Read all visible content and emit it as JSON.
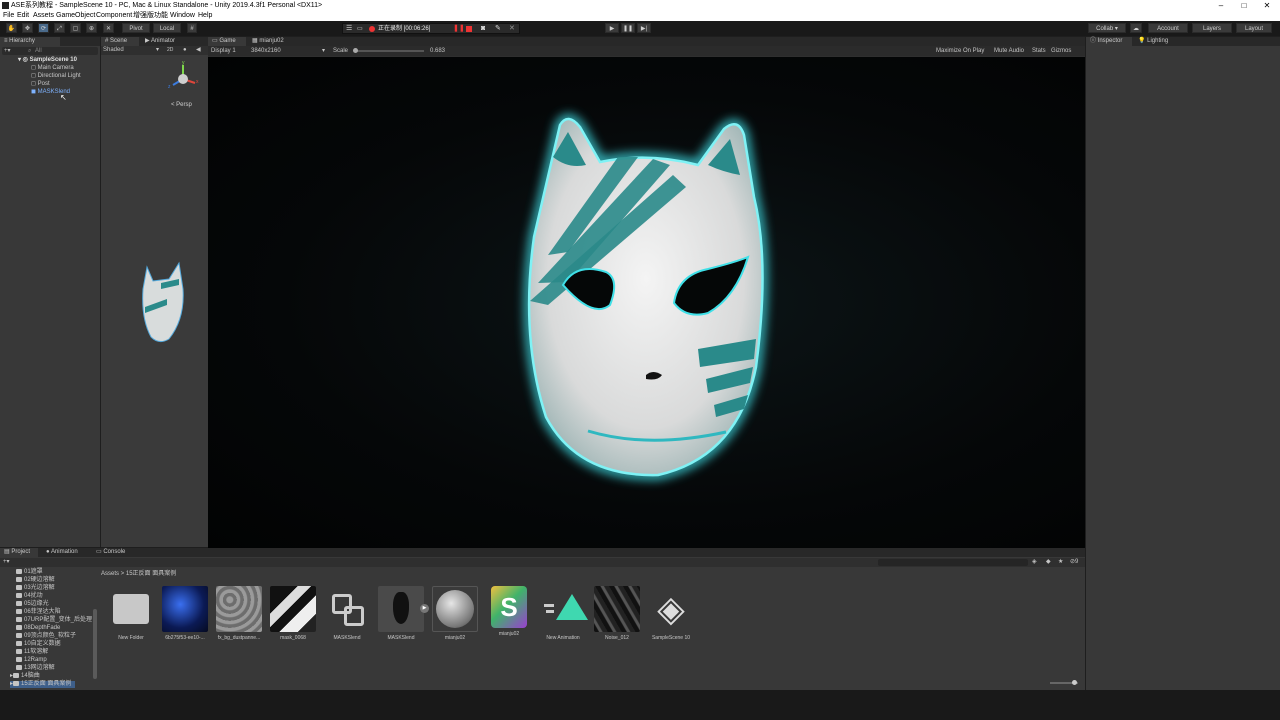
{
  "window": {
    "title": "ASE系列教程 - SampleScene 10 - PC, Mac & Linux Standalone - Unity 2019.4.3f1 Personal <DX11>",
    "minimize": "–",
    "maximize": "□",
    "close": "✕"
  },
  "menu": [
    "File",
    "Edit",
    "Assets",
    "GameObject",
    "Component",
    "增强版功能",
    "Window",
    "Help"
  ],
  "toolbar": {
    "pivot": "Pivot",
    "local": "Local",
    "recording": "正在录制 [00:06:26]",
    "collab": "Collab ▾",
    "account": "Account",
    "layers": "Layers",
    "layout": "Layout"
  },
  "hierarchy": {
    "tab": "Hierarchy",
    "search_placeholder": "All",
    "scene": "SampleScene 10",
    "items": [
      "Main Camera",
      "Directional Light",
      "Post",
      "MASKSlend"
    ]
  },
  "scene_panel": {
    "tabs": [
      "Scene",
      "Animator"
    ],
    "shading": "Shaded",
    "mode": "2D",
    "persp": "< Persp",
    "gizmo_x": "x",
    "gizmo_y": "y",
    "gizmo_z": "z"
  },
  "game_panel": {
    "tabs": [
      "Game",
      "mianju02"
    ],
    "display": "Display 1",
    "resolution": "3840x2160",
    "scale_label": "Scale",
    "scale_value": "0.683",
    "maximize": "Maximize On Play",
    "mute": "Mute Audio",
    "stats": "Stats",
    "gizmos": "Gizmos"
  },
  "inspector": {
    "tabs": [
      "Inspector",
      "Lighting"
    ]
  },
  "project": {
    "tabs": [
      "Project",
      "Animation",
      "Console"
    ],
    "breadcrumb": [
      "Assets",
      "15正反面 面具案例"
    ],
    "folders": [
      "01遮罩",
      "02硬边溶解",
      "03光边溶解",
      "04扰动",
      "05边缘光",
      "06菲涅达大陷",
      "07URP配置_变体_后处理",
      "08DepthFade",
      "09顶点颜色_软粒子",
      "10自定义数据",
      "11软溶解",
      "12Ramp",
      "13网边溶解",
      "14脑曲",
      "15正反面 面具案例"
    ],
    "assets": [
      {
        "name": "New Folder",
        "kind": "folder"
      },
      {
        "name": "6b275f53-ee10-...",
        "kind": "space"
      },
      {
        "name": "fx_bg_dustpanne...",
        "kind": "noise"
      },
      {
        "name": "mask_0068",
        "kind": "mask"
      },
      {
        "name": "MASKSlend",
        "kind": "prefab"
      },
      {
        "name": "MASKSlend",
        "kind": "model"
      },
      {
        "name": "mianju02",
        "kind": "material"
      },
      {
        "name": "mianju02",
        "kind": "shader"
      },
      {
        "name": "New Animation",
        "kind": "anim"
      },
      {
        "name": "Noise_012",
        "kind": "noise2"
      },
      {
        "name": "SampleScene 10",
        "kind": "unity"
      }
    ],
    "hidden_count": "9"
  },
  "colors": {
    "accent": "#3fe0e8",
    "mask_stripe": "#2a8a8a",
    "panel_bg": "#383838",
    "dark_bg": "#191919"
  }
}
